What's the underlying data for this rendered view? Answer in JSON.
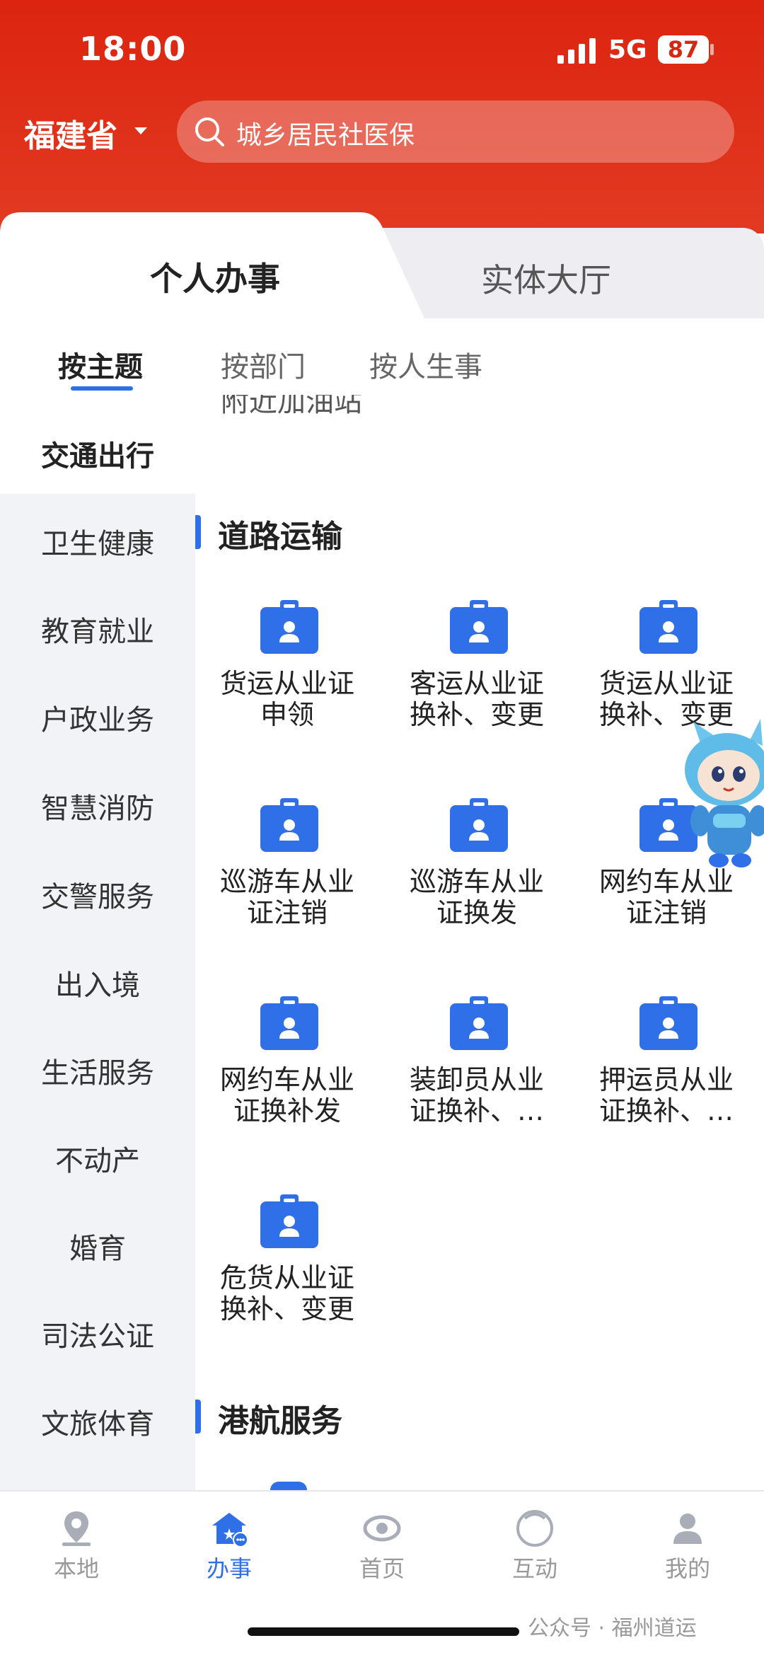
{
  "status_bar": {
    "time": "18:00",
    "network": "5G",
    "battery": "87"
  },
  "header": {
    "province": "福建省",
    "search_placeholder": "城乡居民社医保"
  },
  "main_tabs": [
    {
      "label": "个人办事"
    },
    {
      "label": "实体大厅"
    }
  ],
  "sub_tabs": [
    {
      "label": "按主题"
    },
    {
      "label": "按部门"
    },
    {
      "label": "按人生事"
    }
  ],
  "cut_off_text": "附近加油站",
  "categories": [
    {
      "label": "交通出行"
    },
    {
      "label": "卫生健康"
    },
    {
      "label": "教育就业"
    },
    {
      "label": "户政业务"
    },
    {
      "label": "智慧消防"
    },
    {
      "label": "交警服务"
    },
    {
      "label": "出入境"
    },
    {
      "label": "生活服务"
    },
    {
      "label": "不动产"
    },
    {
      "label": "婚育"
    },
    {
      "label": "司法公证"
    },
    {
      "label": "文旅体育"
    }
  ],
  "sections": [
    {
      "title": "道路运输",
      "items": [
        {
          "label": "货运从业证\n申领"
        },
        {
          "label": "客运从业证\n换补、变更"
        },
        {
          "label": "货运从业证\n换补、变更"
        },
        {
          "label": "巡游车从业\n证注销"
        },
        {
          "label": "巡游车从业\n证换发"
        },
        {
          "label": "网约车从业\n证注销"
        },
        {
          "label": "网约车从业\n证换补发"
        },
        {
          "label": "装卸员从业\n证换补、…"
        },
        {
          "label": "押运员从业\n证换补、…"
        },
        {
          "label": "危货从业证\n换补、变更"
        }
      ]
    },
    {
      "title": "港航服务"
    }
  ],
  "bottom_nav": [
    {
      "label": "本地",
      "icon": "location-icon"
    },
    {
      "label": "办事",
      "icon": "service-hall-icon"
    },
    {
      "label": "首页",
      "icon": "home-eye-icon"
    },
    {
      "label": "互动",
      "icon": "hotline-12345-icon"
    },
    {
      "label": "我的",
      "icon": "user-icon"
    }
  ],
  "watermark": "公众号 · 福州道运",
  "colors": {
    "header_red": "#dc2410",
    "accent_blue": "#2f6fe8",
    "sidebar_bg": "#f2f3f7"
  }
}
